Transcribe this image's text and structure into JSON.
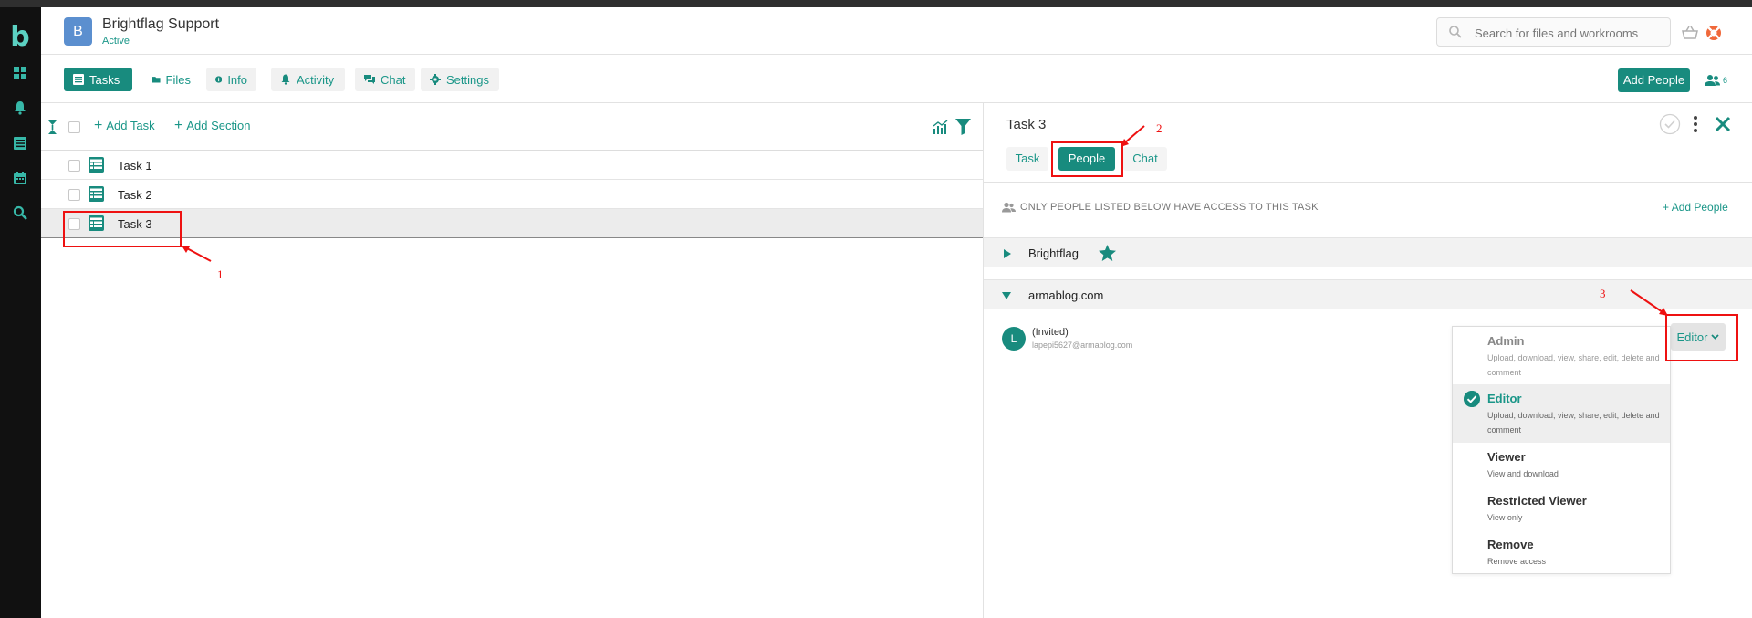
{
  "workspace": {
    "initial": "B",
    "title": "Brightflag Support",
    "status": "Active"
  },
  "search": {
    "placeholder": "Search for files and workrooms"
  },
  "nav": {
    "tabs": [
      {
        "label": "Tasks",
        "icon": "table-icon",
        "active": true
      },
      {
        "label": "Files",
        "icon": "folder-icon"
      },
      {
        "label": "Info",
        "icon": "info-icon"
      },
      {
        "label": "Activity",
        "icon": "bell-icon"
      },
      {
        "label": "Chat",
        "icon": "chat-icon"
      },
      {
        "label": "Settings",
        "icon": "gear-icon"
      }
    ],
    "add_people": "Add People",
    "people_count": "6"
  },
  "tasks": {
    "add_task": "Add Task",
    "add_section": "Add Section",
    "rows": [
      {
        "name": "Task 1"
      },
      {
        "name": "Task 2"
      },
      {
        "name": "Task 3",
        "selected": true
      }
    ]
  },
  "details": {
    "title": "Task 3",
    "tabs": [
      "Task",
      "People",
      "Chat"
    ],
    "active_tab": "People",
    "notice": "ONLY PEOPLE LISTED BELOW HAVE ACCESS TO THIS TASK",
    "add_people": "Add People",
    "groups": [
      {
        "name": "Brightflag",
        "expanded": false
      },
      {
        "name": "armablog.com",
        "expanded": true
      }
    ],
    "member": {
      "initial": "L",
      "name": "(Invited)",
      "email": "lapepi5627@armablog.com",
      "role": "Editor"
    }
  },
  "role_menu": {
    "options": [
      {
        "label": "Admin",
        "desc": "Upload, download, view, share, edit, delete and comment"
      },
      {
        "label": "Editor",
        "desc": "Upload, download, view, share, edit, delete and comment",
        "selected": true
      },
      {
        "label": "Viewer",
        "desc": "View and download"
      },
      {
        "label": "Restricted Viewer",
        "desc": "View only"
      },
      {
        "label": "Remove",
        "desc": "Remove access"
      }
    ]
  },
  "annotations": [
    "1",
    "2",
    "3"
  ],
  "colors": {
    "accent": "#188b7e",
    "annotation": "#e11111",
    "rail": "#111111"
  }
}
